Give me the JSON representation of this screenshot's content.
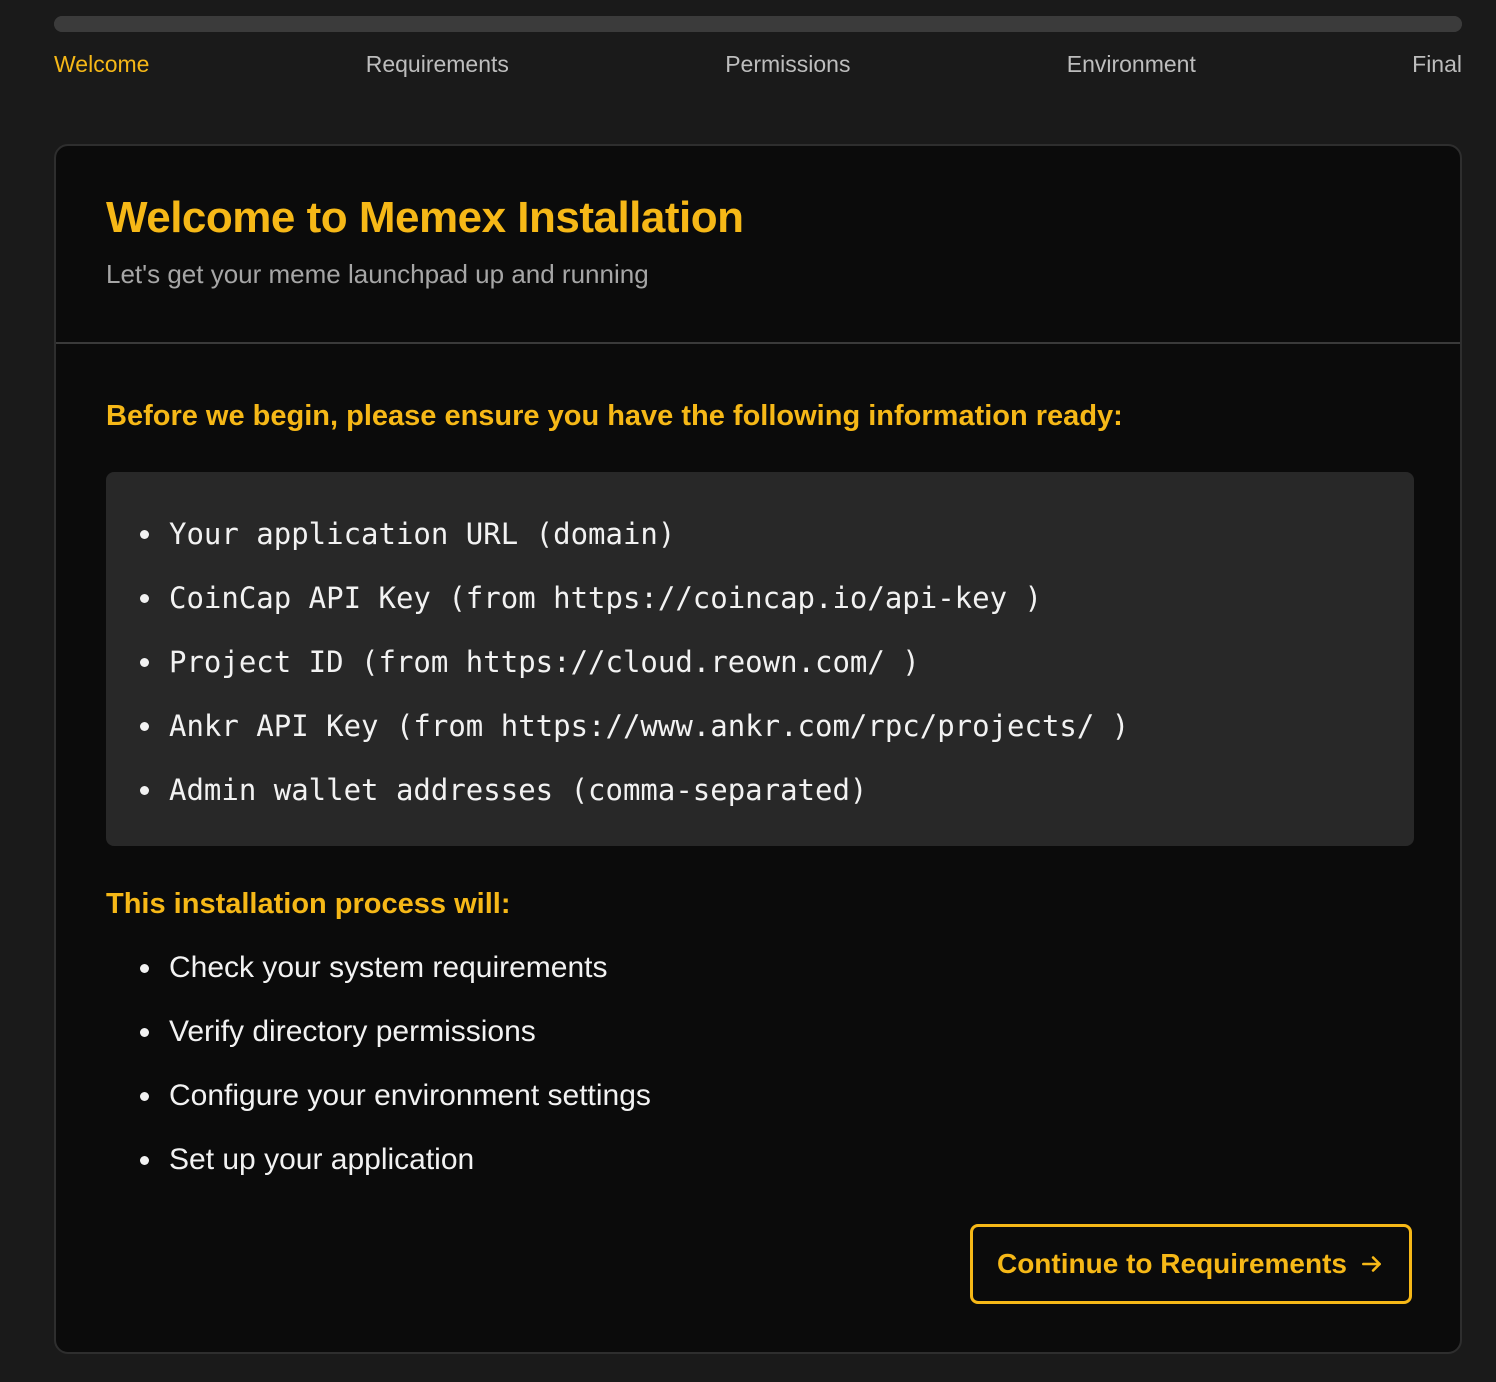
{
  "progress": {
    "value": 1.0
  },
  "steps": [
    {
      "label": "Welcome",
      "active": true
    },
    {
      "label": "Requirements",
      "active": false
    },
    {
      "label": "Permissions",
      "active": false
    },
    {
      "label": "Environment",
      "active": false
    },
    {
      "label": "Final",
      "active": false
    }
  ],
  "header": {
    "title": "Welcome to Memex Installation",
    "subtitle": "Let's get your meme launchpad up and running"
  },
  "prerequisites": {
    "heading": "Before we begin, please ensure you have the following information ready:",
    "items": [
      "Your application URL (domain)",
      "CoinCap API Key (from https://coincap.io/api-key )",
      "Project ID (from https://cloud.reown.com/ )",
      "Ankr API Key (from https://www.ankr.com/rpc/projects/ )",
      "Admin wallet addresses (comma-separated)"
    ]
  },
  "process": {
    "heading": "This installation process will:",
    "items": [
      "Check your system requirements",
      "Verify directory permissions",
      "Configure your environment settings",
      "Set up your application"
    ]
  },
  "continue_button": {
    "label": "Continue to Requirements",
    "icon": "arrow-right-icon"
  },
  "colors": {
    "accent": "#f6b817",
    "background": "#1a1a1a",
    "card": "#0b0b0b",
    "code_box": "#282828"
  }
}
